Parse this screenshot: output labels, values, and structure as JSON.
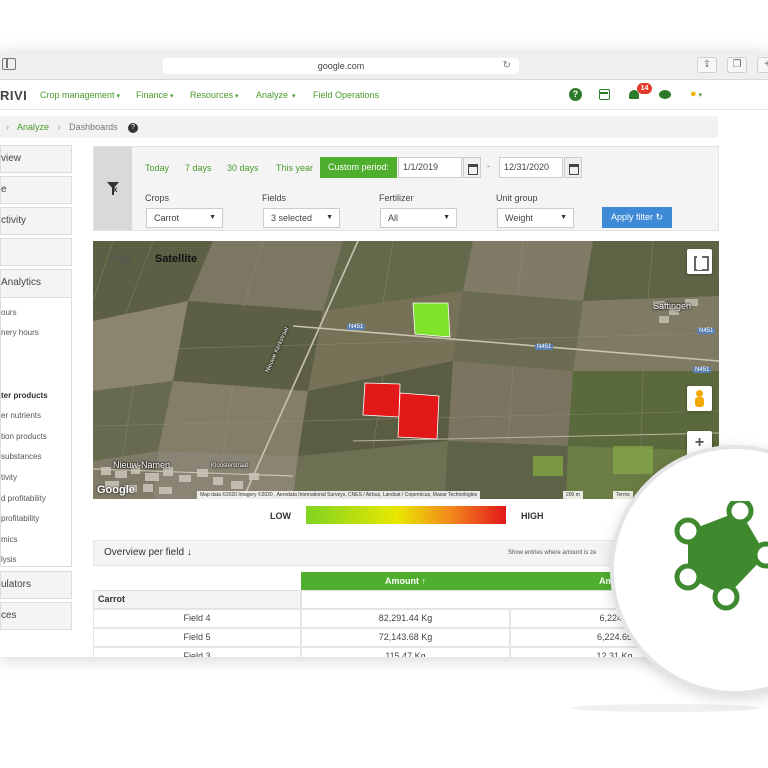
{
  "browser": {
    "url": "google.com"
  },
  "app": {
    "logo": "RIVI",
    "nav": [
      {
        "label": "Crop management"
      },
      {
        "label": "Finance"
      },
      {
        "label": "Resources"
      },
      {
        "label": "Analyze"
      },
      {
        "label": "Field Operations"
      }
    ],
    "notifications_count": "14",
    "help_glyph": "?"
  },
  "breadcrumb": {
    "items": [
      "Analyze",
      "Dashboards"
    ]
  },
  "sidebar": {
    "top_items": [
      "view",
      "e",
      "ctivity",
      ""
    ],
    "analytics_header": "Analytics",
    "analytics_items": [
      "ours",
      "nery hours",
      "",
      "",
      "ter products",
      "er nutrients",
      "tion products",
      "substances",
      "tivity",
      "d profitability",
      "profitability",
      "mics",
      "lysis"
    ],
    "bottom_items": [
      "ulators",
      "ces"
    ]
  },
  "filter": {
    "periods": [
      "Today",
      "7 days",
      "30 days",
      "This year"
    ],
    "custom_period": "Custom period:",
    "date_from": "1/1/2019",
    "date_to": "12/31/2020",
    "date_separator": "-",
    "fields": [
      {
        "label": "Crops",
        "value": "Carrot"
      },
      {
        "label": "Fields",
        "value": "3 selected"
      },
      {
        "label": "Fertilizer",
        "value": "All"
      },
      {
        "label": "Unit group",
        "value": "Weight"
      }
    ],
    "apply_label": "Apply filter"
  },
  "map": {
    "tab_map": "Map",
    "tab_satellite": "Satellite",
    "active_tab": "Satellite",
    "labels": {
      "village_right": "Saftingen",
      "village_left": "Nieuw-Namen",
      "street": "Kloosterstraat",
      "diagonal_road": "Nieuwe Kerkstraat"
    },
    "road_badges": [
      "N451",
      "N451",
      "N451",
      "N451"
    ],
    "google": "Google",
    "attribution": "Map data ©2020 Imagery ©2020 , Aerodata International Surveys, CNES / Airbus, Landsat / Copernicus, Maxar Technologies",
    "scale": "200 m",
    "terms": "Terms",
    "fields": [
      {
        "name": "Field 3",
        "level": "low",
        "color": "#7ee32a"
      },
      {
        "name": "Field 4",
        "level": "high",
        "color": "#e31818"
      },
      {
        "name": "Field 5",
        "level": "high",
        "color": "#e31818"
      }
    ]
  },
  "legend": {
    "low": "LOW",
    "high": "HIGH",
    "colors": [
      "#7ed321",
      "#e8e800",
      "#f28a1c",
      "#e2171b"
    ]
  },
  "overview": {
    "title": "Overview per field",
    "show_entries": "Show entries where amount is ze",
    "columns": [
      "Amount",
      "Amoun"
    ],
    "group": "Carrot",
    "rows": [
      {
        "field": "Field 4",
        "amount": "82,291.44 Kg",
        "amount2": "6,224.6"
      },
      {
        "field": "Field 5",
        "amount": "72,143.68 Kg",
        "amount2": "6,224.65"
      },
      {
        "field": "Field 3",
        "amount": "115.47 Kg",
        "amount2": "12.31 Kg"
      }
    ]
  },
  "colors": {
    "brand_green": "#4fae2e",
    "dark_green": "#2f7a2a",
    "apply_blue": "#3e8ad6",
    "badge_red": "#e23b2e"
  }
}
